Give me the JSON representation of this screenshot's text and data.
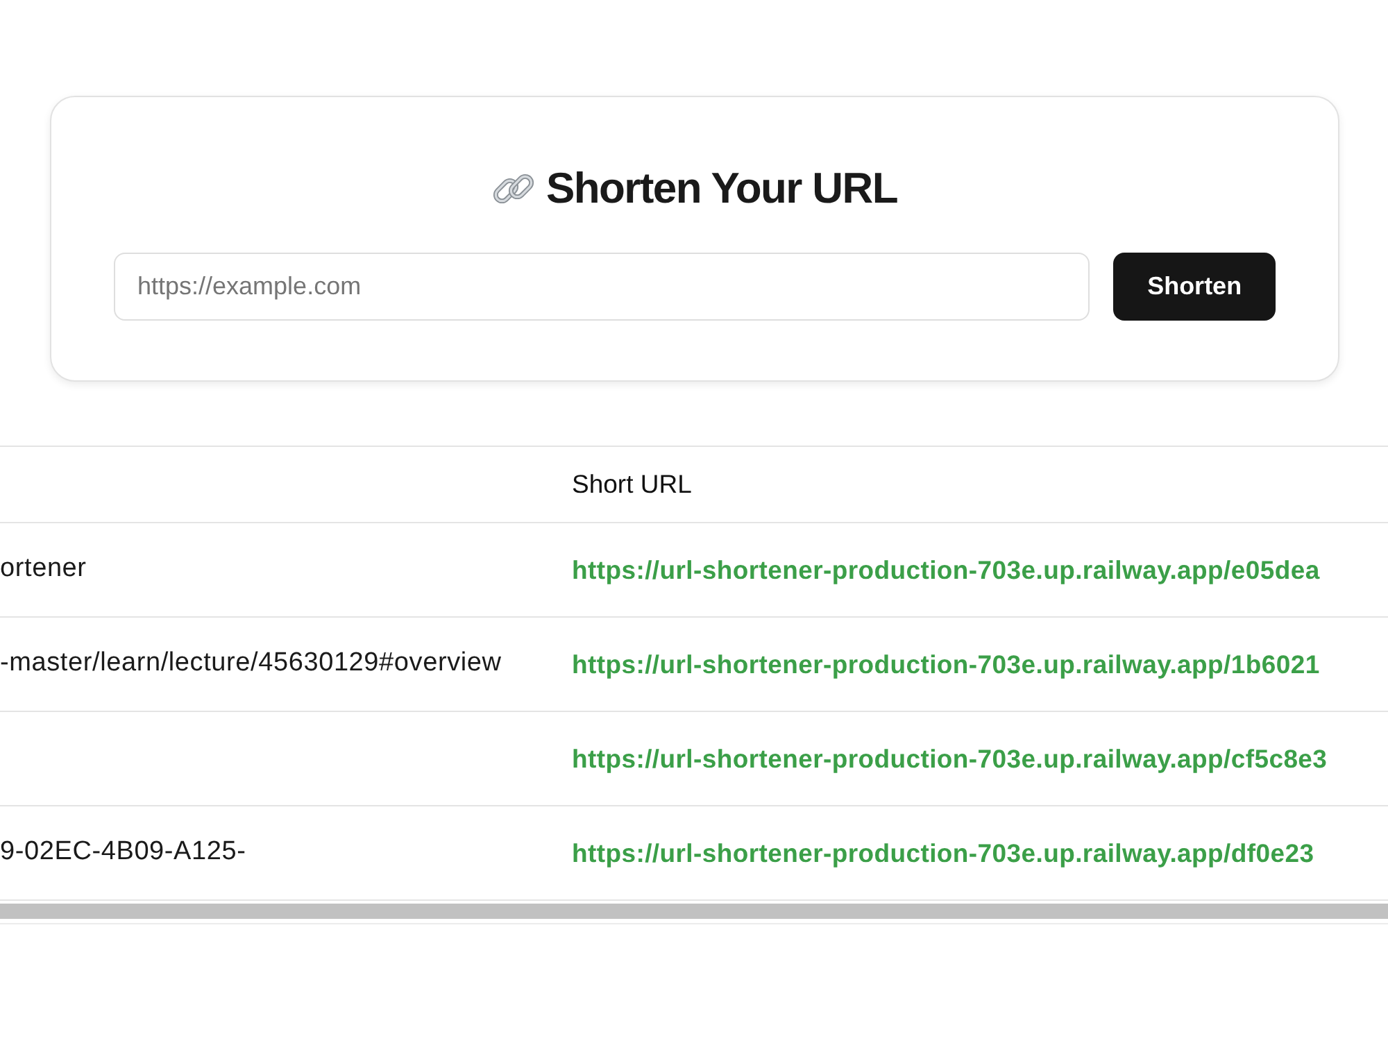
{
  "card": {
    "title": "Shorten Your URL",
    "url_input": {
      "placeholder": "https://example.com"
    },
    "submit_button": "Shorten"
  },
  "table": {
    "short_url_heading": "Short URL",
    "rows": [
      {
        "column_1": "ortener",
        "short_url": "https://url-shortener-production-703e.up.railway.app/e05dea"
      },
      {
        "column_1": "-master/learn/lecture/45630129#overview",
        "short_url": "https://url-shortener-production-703e.up.railway.app/1b6021"
      },
      {
        "short_url": "https://url-shortener-production-703e.up.railway.app/cf5c8e3"
      },
      {
        "column_1": "9-02EC-4B09-A125-",
        "short_url": "https://url-shortener-production-703e.up.railway.app/df0e23"
      }
    ]
  }
}
